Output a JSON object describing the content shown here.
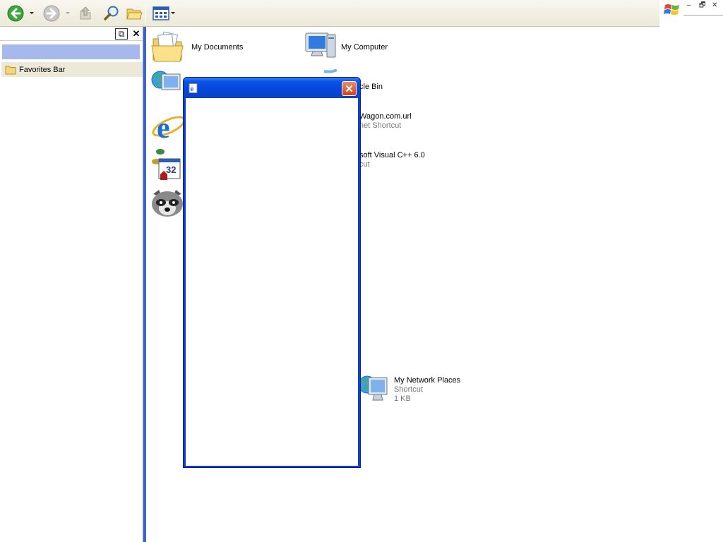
{
  "toolbar": {
    "back": "back-icon",
    "forward": "forward-icon",
    "up": "up-folder-icon",
    "search": "search-icon",
    "folders": "folders-icon",
    "views": "views-icon"
  },
  "window_controls": {
    "minimize": "–",
    "restore": "🗗",
    "close": "✕"
  },
  "sidebar": {
    "pin_icon": "⧉",
    "close_icon": "✕",
    "favorites_label": "Favorites Bar"
  },
  "items": {
    "my_documents": {
      "name": "My Documents"
    },
    "my_computer": {
      "name": "My Computer"
    },
    "recycle_bin": {
      "name": "cle Bin"
    },
    "wagon": {
      "name": "Wagon.com.url",
      "type": "net Shortcut"
    },
    "visual_cpp": {
      "name": "soft Visual C++ 6.0",
      "type": "cut"
    },
    "network": {
      "name": "My Network Places",
      "type": "Shortcut",
      "size": "1 KB"
    }
  },
  "colors": {
    "accent": "#0b3fd8",
    "selection": "#a6b8ec",
    "close_red": "#d4401b"
  }
}
